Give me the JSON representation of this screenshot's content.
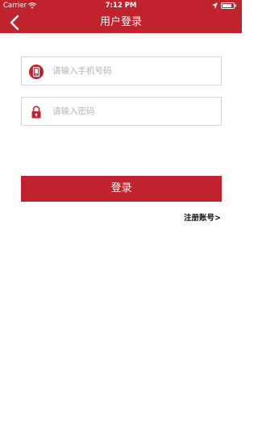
{
  "status_bar": {
    "carrier": "Carrier",
    "time": "7:12 PM"
  },
  "nav": {
    "title": "用户登录"
  },
  "form": {
    "phone_placeholder": "请输入手机号码",
    "password_placeholder": "请输入密码",
    "login_label": "登录",
    "register_label": "注册账号>"
  },
  "colors": {
    "brand": "#c0222e",
    "field_border": "#d6d6d6",
    "placeholder": "#b5b5b5"
  },
  "icons": {
    "back": "chevron-left-icon",
    "phone": "phone-icon",
    "password": "lock-icon",
    "wifi": "wifi-icon",
    "location": "location-arrow-icon",
    "battery": "battery-icon"
  }
}
